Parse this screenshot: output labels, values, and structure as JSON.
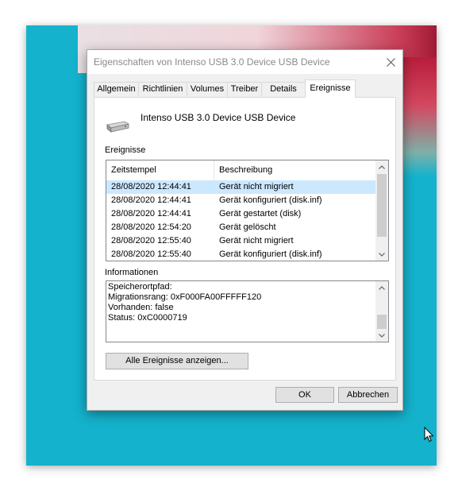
{
  "dialog": {
    "title": "Eigenschaften von Intenso USB 3.0 Device USB Device",
    "close_label": "×"
  },
  "tabs": [
    {
      "label": "Allgemein",
      "active": false
    },
    {
      "label": "Richtlinien",
      "active": false
    },
    {
      "label": "Volumes",
      "active": false
    },
    {
      "label": "Treiber",
      "active": false
    },
    {
      "label": "Details",
      "active": false
    },
    {
      "label": "Ereignisse",
      "active": true
    }
  ],
  "device": {
    "icon": "usb-drive-icon",
    "name": "Intenso USB 3.0 Device USB Device"
  },
  "events": {
    "section_label": "Ereignisse",
    "columns": [
      "Zeitstempel",
      "Beschreibung"
    ],
    "rows": [
      {
        "timestamp": "28/08/2020 12:44:41",
        "description": "Gerät nicht migriert",
        "selected": true
      },
      {
        "timestamp": "28/08/2020 12:44:41",
        "description": "Gerät konfiguriert (disk.inf)",
        "selected": false
      },
      {
        "timestamp": "28/08/2020 12:44:41",
        "description": "Gerät gestartet (disk)",
        "selected": false
      },
      {
        "timestamp": "28/08/2020 12:54:20",
        "description": "Gerät gelöscht",
        "selected": false
      },
      {
        "timestamp": "28/08/2020 12:55:40",
        "description": "Gerät nicht migriert",
        "selected": false
      },
      {
        "timestamp": "28/08/2020 12:55:40",
        "description": "Gerät konfiguriert (disk.inf)",
        "selected": false
      }
    ]
  },
  "info": {
    "section_label": "Informationen",
    "lines": [
      "Speicherortpfad:",
      "Migrationsrang: 0xF000FA00FFFFF120",
      "Vorhanden: false",
      "Status: 0xC0000719"
    ]
  },
  "buttons": {
    "show_all": "Alle Ereignisse anzeigen...",
    "ok": "OK",
    "cancel": "Abbrechen"
  },
  "colors": {
    "desktop": "#14b2cc",
    "selection": "#cce8ff",
    "dialog_bg": "#f0f0f0"
  }
}
